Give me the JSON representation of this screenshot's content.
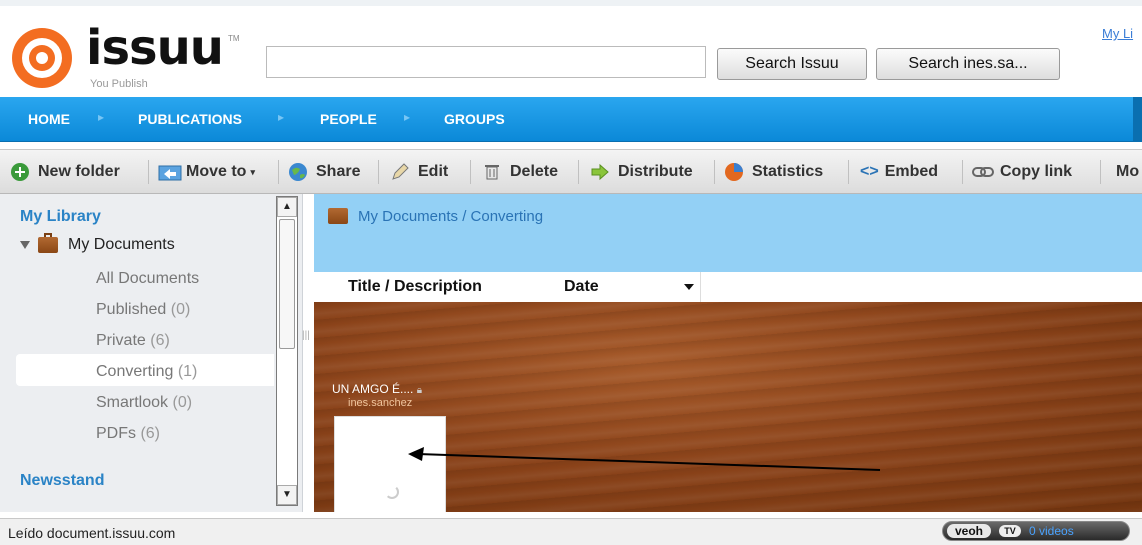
{
  "header": {
    "brand": "issuu",
    "tm": "TM",
    "tagline": "You Publish",
    "search_placeholder": "",
    "search_button": "Search Issuu",
    "search_user_button": "Search ines.sa...",
    "my_library_link": "My Li"
  },
  "nav": {
    "items": [
      {
        "label": "HOME"
      },
      {
        "label": "PUBLICATIONS"
      },
      {
        "label": "PEOPLE"
      },
      {
        "label": "GROUPS"
      }
    ]
  },
  "toolbar": {
    "new_folder": "New folder",
    "move_to": "Move to",
    "share": "Share",
    "edit": "Edit",
    "delete": "Delete",
    "distribute": "Distribute",
    "statistics": "Statistics",
    "embed": "Embed",
    "copy_link": "Copy link",
    "more": "Mo"
  },
  "sidebar": {
    "title": "My Library",
    "root": "My Documents",
    "items": [
      {
        "label": "All Documents",
        "count": ""
      },
      {
        "label": "Published",
        "count": "(0)"
      },
      {
        "label": "Private",
        "count": "(6)"
      },
      {
        "label": "Converting",
        "count": "(1)"
      },
      {
        "label": "Smartlook",
        "count": "(0)"
      },
      {
        "label": "PDFs",
        "count": "(6)"
      }
    ],
    "newsstand": "Newsstand"
  },
  "main": {
    "breadcrumb": "My Documents / Converting",
    "columns": {
      "title": "Title / Description",
      "date": "Date"
    },
    "document": {
      "title": "UN AMGO É....",
      "user": "ines.sanchez"
    }
  },
  "statusbar": {
    "text": "Leído document.issuu.com",
    "veoh_logo": "veoh",
    "veoh_badge": "TV",
    "veoh_count": "0 videos"
  },
  "colors": {
    "nav_blue": "#0b89d8",
    "crumb_bg": "#93d0f5",
    "link_blue": "#2a83c6",
    "logo_orange": "#f36d21"
  }
}
